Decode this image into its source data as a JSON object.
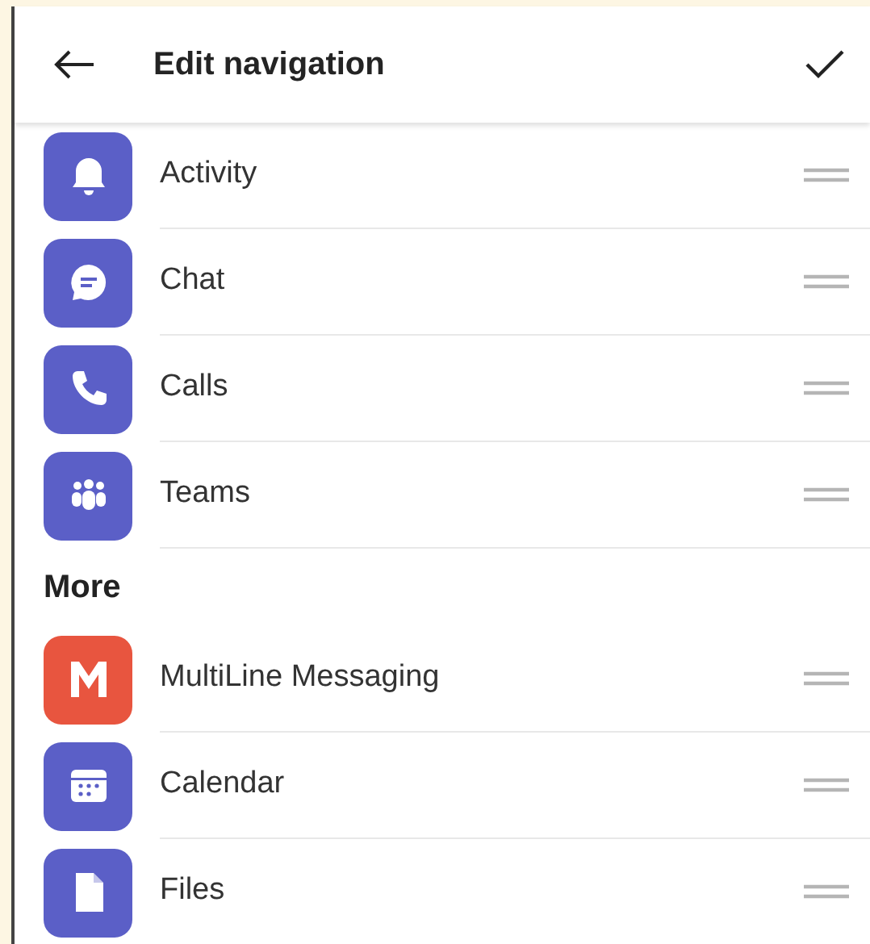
{
  "header": {
    "title": "Edit navigation"
  },
  "sections": [
    {
      "items": [
        {
          "label": "Activity",
          "color": "#5b5fc7"
        },
        {
          "label": "Chat",
          "color": "#5b5fc7"
        },
        {
          "label": "Calls",
          "color": "#5b5fc7"
        },
        {
          "label": "Teams",
          "color": "#5b5fc7"
        }
      ]
    },
    {
      "heading": "More",
      "items": [
        {
          "label": "MultiLine Messaging",
          "color": "#e8553f"
        },
        {
          "label": "Calendar",
          "color": "#5b5fc7"
        },
        {
          "label": "Files",
          "color": "#5b5fc7"
        }
      ]
    }
  ]
}
